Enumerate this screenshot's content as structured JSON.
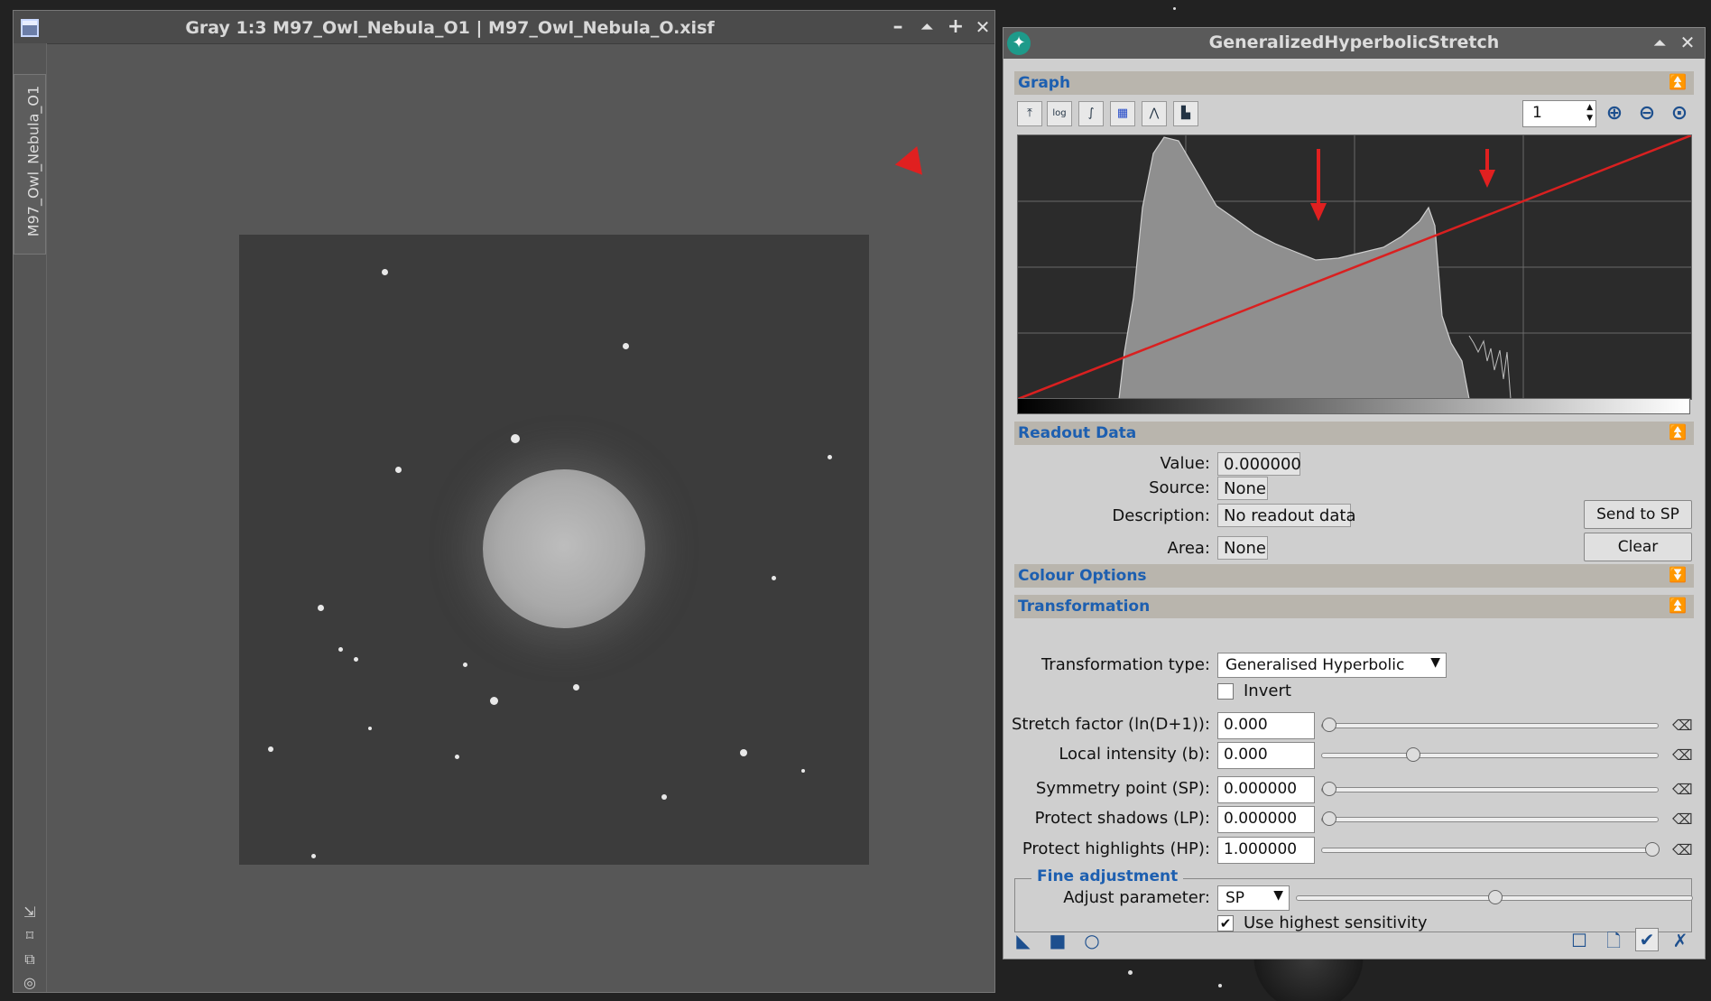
{
  "image_window": {
    "title": "Gray 1:3 M97_Owl_Nebula_O1 | M97_Owl_Nebula_O.xisf",
    "side_tab": "M97_Owl_Nebula_O1",
    "btn_minimize": "–",
    "btn_shade": "⏶",
    "btn_maximize": "+",
    "btn_close": "✕"
  },
  "ghs": {
    "title": "GeneralizedHyperbolicStretch",
    "btn_shade": "⏶",
    "btn_close": "✕",
    "graph_section": "Graph",
    "zoom_value": "1",
    "readout_section": "Readout Data",
    "readout": {
      "value_label": "Value:",
      "value": "0.000000",
      "source_label": "Source:",
      "source": "None",
      "description_label": "Description:",
      "description": "No readout data",
      "area_label": "Area:",
      "area": "None",
      "send_button": "Send to SP",
      "clear_button": "Clear"
    },
    "colour_section": "Colour Options",
    "transform_section": "Transformation",
    "transformation": {
      "type_label": "Transformation type:",
      "type_value": "Generalised Hyperbolic",
      "invert_label": "Invert",
      "invert_checked": false,
      "params": [
        {
          "label": "Stretch factor (ln(D+1)):",
          "value": "0.000",
          "fraction": 0.0
        },
        {
          "label": "Local intensity (b):",
          "value": "0.000",
          "fraction": 0.26
        },
        {
          "label": "Symmetry point (SP):",
          "value": "0.000000",
          "fraction": 0.0
        },
        {
          "label": "Protect shadows (LP):",
          "value": "0.000000",
          "fraction": 0.0
        },
        {
          "label": "Protect highlights (HP):",
          "value": "1.000000",
          "fraction": 1.0
        }
      ]
    },
    "fine": {
      "legend": "Fine adjustment",
      "adjust_label": "Adjust parameter:",
      "adjust_value": "SP",
      "adjust_fraction": 0.5,
      "sensitivity_label": "Use highest sensitivity",
      "sensitivity_checked": true
    }
  },
  "colors": {
    "accent": "#1d5fb0",
    "annotation": "#e02020",
    "curve": "#d92020"
  }
}
